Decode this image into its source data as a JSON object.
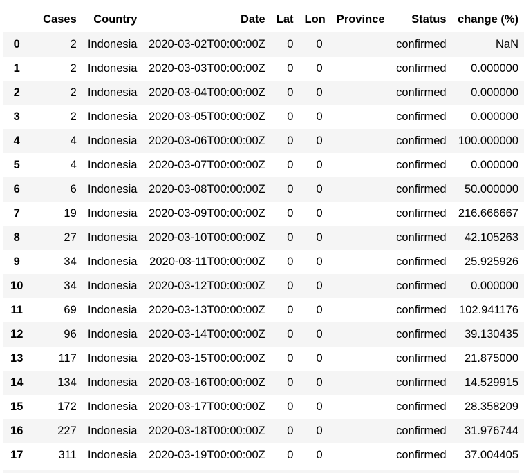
{
  "table": {
    "columns": [
      "",
      "Cases",
      "Country",
      "Date",
      "Lat",
      "Lon",
      "Province",
      "Status",
      "change (%)"
    ],
    "rows": [
      [
        "0",
        "2",
        "Indonesia",
        "2020-03-02T00:00:00Z",
        "0",
        "0",
        "",
        "confirmed",
        "NaN"
      ],
      [
        "1",
        "2",
        "Indonesia",
        "2020-03-03T00:00:00Z",
        "0",
        "0",
        "",
        "confirmed",
        "0.000000"
      ],
      [
        "2",
        "2",
        "Indonesia",
        "2020-03-04T00:00:00Z",
        "0",
        "0",
        "",
        "confirmed",
        "0.000000"
      ],
      [
        "3",
        "2",
        "Indonesia",
        "2020-03-05T00:00:00Z",
        "0",
        "0",
        "",
        "confirmed",
        "0.000000"
      ],
      [
        "4",
        "4",
        "Indonesia",
        "2020-03-06T00:00:00Z",
        "0",
        "0",
        "",
        "confirmed",
        "100.000000"
      ],
      [
        "5",
        "4",
        "Indonesia",
        "2020-03-07T00:00:00Z",
        "0",
        "0",
        "",
        "confirmed",
        "0.000000"
      ],
      [
        "6",
        "6",
        "Indonesia",
        "2020-03-08T00:00:00Z",
        "0",
        "0",
        "",
        "confirmed",
        "50.000000"
      ],
      [
        "7",
        "19",
        "Indonesia",
        "2020-03-09T00:00:00Z",
        "0",
        "0",
        "",
        "confirmed",
        "216.666667"
      ],
      [
        "8",
        "27",
        "Indonesia",
        "2020-03-10T00:00:00Z",
        "0",
        "0",
        "",
        "confirmed",
        "42.105263"
      ],
      [
        "9",
        "34",
        "Indonesia",
        "2020-03-11T00:00:00Z",
        "0",
        "0",
        "",
        "confirmed",
        "25.925926"
      ],
      [
        "10",
        "34",
        "Indonesia",
        "2020-03-12T00:00:00Z",
        "0",
        "0",
        "",
        "confirmed",
        "0.000000"
      ],
      [
        "11",
        "69",
        "Indonesia",
        "2020-03-13T00:00:00Z",
        "0",
        "0",
        "",
        "confirmed",
        "102.941176"
      ],
      [
        "12",
        "96",
        "Indonesia",
        "2020-03-14T00:00:00Z",
        "0",
        "0",
        "",
        "confirmed",
        "39.130435"
      ],
      [
        "13",
        "117",
        "Indonesia",
        "2020-03-15T00:00:00Z",
        "0",
        "0",
        "",
        "confirmed",
        "21.875000"
      ],
      [
        "14",
        "134",
        "Indonesia",
        "2020-03-16T00:00:00Z",
        "0",
        "0",
        "",
        "confirmed",
        "14.529915"
      ],
      [
        "15",
        "172",
        "Indonesia",
        "2020-03-17T00:00:00Z",
        "0",
        "0",
        "",
        "confirmed",
        "28.358209"
      ],
      [
        "16",
        "227",
        "Indonesia",
        "2020-03-18T00:00:00Z",
        "0",
        "0",
        "",
        "confirmed",
        "31.976744"
      ],
      [
        "17",
        "311",
        "Indonesia",
        "2020-03-19T00:00:00Z",
        "0",
        "0",
        "",
        "confirmed",
        "37.004405"
      ]
    ]
  },
  "colors": {
    "stripe": "#f5f5f5",
    "header_rule": "#bdbdbd",
    "text": "#000000"
  }
}
